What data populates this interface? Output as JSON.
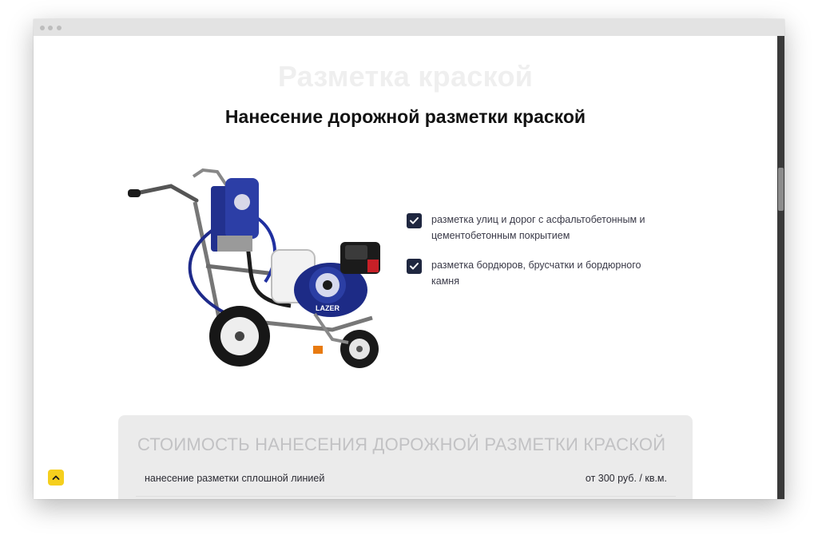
{
  "page": {
    "ghost_title": "Разметка краской",
    "title": "Нанесение дорожной разметки краской"
  },
  "product_image": {
    "logo_text": "LAZER"
  },
  "features": [
    {
      "text": "разметка улиц и дорог с асфальтобетонным и цементобетонным покрытием"
    },
    {
      "text": "разметка бордюров, брусчатки и бордюрного камня"
    }
  ],
  "pricing": {
    "title": "СТОИМОСТЬ НАНЕСЕНИЯ ДОРОЖНОЙ РАЗМЕТКИ КРАСКОЙ",
    "rows": [
      {
        "name": "нанесение разметки сплошной линией",
        "price": "от 300 руб. / кв.м."
      }
    ]
  },
  "colors": {
    "accent": "#1f2740",
    "scroll_button": "#f5cf1d",
    "panel": "#ebebeb"
  },
  "icons": {
    "checkbox": "check-icon",
    "scroll_top": "chevron-up-icon"
  }
}
